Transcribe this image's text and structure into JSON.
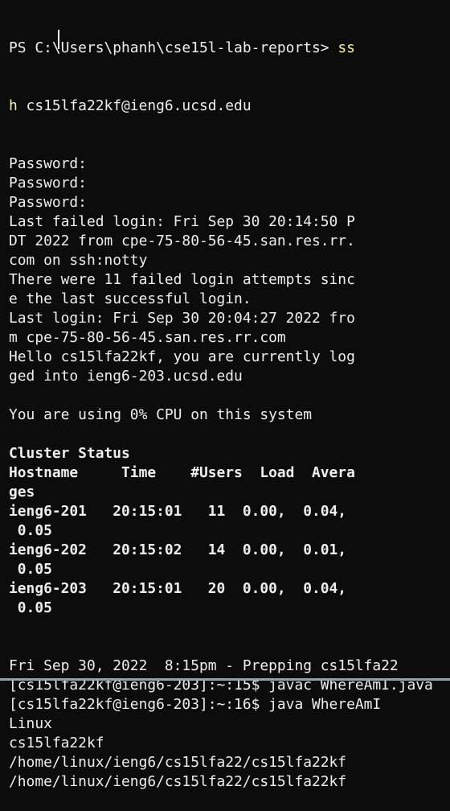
{
  "terminal": {
    "colors": {
      "background": "#0c0c0c",
      "text": "#eeeeee",
      "command": "#f9f1a5"
    },
    "prompt_line": {
      "prompt": "PS C:\\Users\\phanh\\cse15l-lab-reports> ",
      "command_part1": "ss"
    },
    "command_line": {
      "command_part2": "h",
      "argument": " cs15lfa22kf@ieng6.ucsd.edu"
    },
    "lines": [
      {
        "text": "Password:",
        "bold": false
      },
      {
        "text": "Password:",
        "bold": false
      },
      {
        "text": "Password:",
        "bold": false
      },
      {
        "text": "Last failed login: Fri Sep 30 20:14:50 P",
        "bold": false
      },
      {
        "text": "DT 2022 from cpe-75-80-56-45.san.res.rr.",
        "bold": false
      },
      {
        "text": "com on ssh:notty",
        "bold": false
      },
      {
        "text": "There were 11 failed login attempts sinc",
        "bold": false
      },
      {
        "text": "e the last successful login.",
        "bold": false
      },
      {
        "text": "Last login: Fri Sep 30 20:04:27 2022 fro",
        "bold": false
      },
      {
        "text": "m cpe-75-80-56-45.san.res.rr.com",
        "bold": false
      },
      {
        "text": "Hello cs15lfa22kf, you are currently log",
        "bold": false
      },
      {
        "text": "ged into ieng6-203.ucsd.edu",
        "bold": false
      },
      {
        "text": "",
        "bold": false
      },
      {
        "text": "You are using 0% CPU on this system",
        "bold": false
      },
      {
        "text": "",
        "bold": false
      },
      {
        "text": "Cluster Status",
        "bold": true
      },
      {
        "text": "Hostname     Time    #Users  Load  Avera",
        "bold": true
      },
      {
        "text": "ges",
        "bold": true
      },
      {
        "text": "ieng6-201   20:15:01   11  0.00,  0.04,",
        "bold": true
      },
      {
        "text": " 0.05",
        "bold": true
      },
      {
        "text": "ieng6-202   20:15:02   14  0.00,  0.01,",
        "bold": true
      },
      {
        "text": " 0.05",
        "bold": true
      },
      {
        "text": "ieng6-203   20:15:01   20  0.00,  0.04,",
        "bold": true
      },
      {
        "text": " 0.05",
        "bold": true
      },
      {
        "text": "",
        "bold": false
      },
      {
        "text": "",
        "bold": false
      },
      {
        "text": "Fri Sep 30, 2022  8:15pm - Prepping cs15lfa22",
        "bold": false
      },
      {
        "text": "[cs15lfa22kf@ieng6-203]:~:15$ javac WhereAmI.java",
        "bold": false
      },
      {
        "text": "[cs15lfa22kf@ieng6-203]:~:16$ java WhereAmI",
        "bold": false
      },
      {
        "text": "Linux",
        "bold": false
      },
      {
        "text": "cs15lfa22kf",
        "bold": false
      },
      {
        "text": "/home/linux/ieng6/cs15lfa22/cs15lfa22kf",
        "bold": false
      },
      {
        "text": "/home/linux/ieng6/cs15lfa22/cs15lfa22kf",
        "bold": false
      }
    ]
  }
}
